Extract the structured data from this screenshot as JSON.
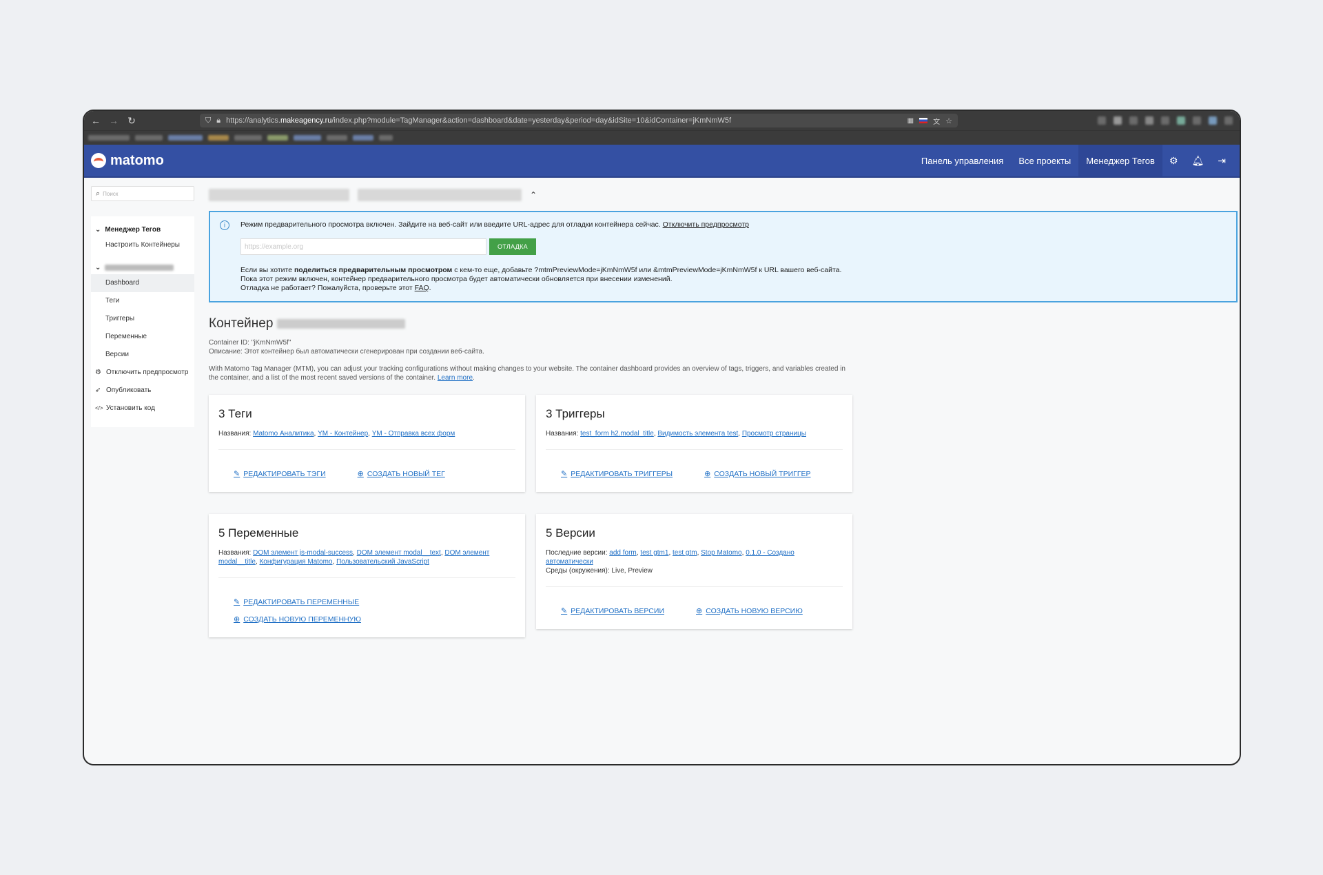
{
  "browser": {
    "url_prefix": "https://analytics.",
    "url_host": "makeagency.ru",
    "url_suffix": "/index.php?module=TagManager&action=dashboard&date=yesterday&period=day&idSite=10&idContainer=jKmNmW5f"
  },
  "header": {
    "logo": "matomo",
    "nav": [
      "Панель управления",
      "Все проекты",
      "Менеджер Тегов"
    ],
    "icons": [
      "gear-icon",
      "bell-icon",
      "logout-icon"
    ]
  },
  "sidebar": {
    "search_placeholder": "Поиск",
    "category1": "Менеджер Тегов",
    "category1_item": "Настроить Контейнеры",
    "items": [
      "Dashboard",
      "Теги",
      "Триггеры",
      "Переменные",
      "Версии",
      "Отключить предпросмотр",
      "Опубликовать",
      "Установить код"
    ]
  },
  "notice": {
    "text": "Режим предварительного просмотра включен. Зайдите на веб-сайт или введите URL-адрес для отладки контейнера сейчас.",
    "disable_link": "Отключить предпросмотр",
    "url_placeholder": "https://example.org",
    "debug_button": "ОТЛАДКА",
    "share_prefix": "Если вы хотите ",
    "share_bold": "поделиться предварительным просмотром",
    "share_suffix": " с кем-то еще, добавьте ?mtmPreviewMode=jKmNmW5f или &mtmPreviewMode=jKmNmW5f к URL вашего веб-сайта.",
    "share_line2": "Пока этот режим включен, контейнер предварительного просмотра будет автоматически обновляется при внесении изменений.",
    "faq_prefix": "Отладка не работает? Пожалуйста, проверьте этот ",
    "faq_link": "FAQ",
    "faq_suffix": "."
  },
  "container": {
    "title": "Контейнер",
    "id_line": "Container ID: \"jKmNmW5f\"",
    "description": "Описание: Этот контейнер был автоматически сгенерирован при создании веб-сайта.",
    "about": "With Matomo Tag Manager (MTM), you can adjust your tracking configurations without making changes to your website. The container dashboard provides an overview of tags, triggers, and variables created in the container, and a list of the most recent saved versions of the container. ",
    "learn_more": "Learn more",
    "about_end": "."
  },
  "cards": {
    "tags": {
      "title": "3 Теги",
      "label": "Названия: ",
      "names": [
        "Matomo Аналитика",
        "YM - Контейнер",
        "YM - Отправка всех форм"
      ],
      "edit": "РЕДАКТИРОВАТЬ ТЭГИ",
      "create": "СОЗДАТЬ НОВЫЙ ТЕГ"
    },
    "triggers": {
      "title": "3 Триггеры",
      "label": "Названия: ",
      "names": [
        "test_form h2.modal_title",
        "Видимость элемента test",
        "Просмотр страницы"
      ],
      "edit": "РЕДАКТИРОВАТЬ ТРИГГЕРЫ",
      "create": "СОЗДАТЬ НОВЫЙ ТРИГГЕР"
    },
    "variables": {
      "title": "5 Переменные",
      "label": "Названия: ",
      "names": [
        "DOM элемент js-modal-success",
        "DOM элемент modal__text",
        "DOM элемент modal__title",
        "Конфигурация Matomo",
        "Пользовательский JavaScript"
      ],
      "edit": "РЕДАКТИРОВАТЬ ПЕРЕМЕННЫЕ",
      "create": "СОЗДАТЬ НОВУЮ ПЕРЕМЕННУЮ"
    },
    "versions": {
      "title": "5 Версии",
      "label": "Последние версии: ",
      "names": [
        "add form",
        "test gtm1",
        "test gtm",
        "Stop Matomo",
        "0.1.0 - Создано автоматически"
      ],
      "env": "Среды (окружения): Live, Preview",
      "edit": "РЕДАКТИРОВАТЬ ВЕРСИИ",
      "create": "СОЗДАТЬ НОВУЮ ВЕРСИЮ"
    }
  }
}
